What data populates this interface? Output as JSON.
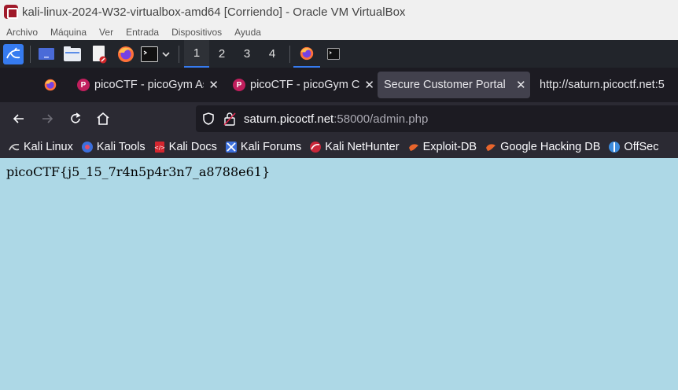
{
  "window": {
    "title": "kali-linux-2024-W32-virtualbox-amd64 [Corriendo] - Oracle VM VirtualBox",
    "menu": [
      "Archivo",
      "Máquina",
      "Ver",
      "Entrada",
      "Dispositivos",
      "Ayuda"
    ]
  },
  "panel": {
    "workspaces": [
      "1",
      "2",
      "3",
      "4"
    ],
    "active_workspace": "1"
  },
  "tabs": [
    {
      "label": "picoCTF - picoGym As",
      "favicon": "picoctf-icon",
      "active": false
    },
    {
      "label": "picoCTF - picoGym Cl",
      "favicon": "picoctf-icon",
      "active": false
    },
    {
      "label": "Secure Customer Portal",
      "favicon": "",
      "active": true
    },
    {
      "label": "http://saturn.picoctf.net:5",
      "favicon": "",
      "active": false
    }
  ],
  "address": {
    "host": "saturn.picoctf.net",
    "rest": ":58000/admin.php"
  },
  "bookmarks": [
    {
      "label": "Kali Linux",
      "icon": "kali-dragon-icon"
    },
    {
      "label": "Kali Tools",
      "icon": "kali-tools-icon"
    },
    {
      "label": "Kali Docs",
      "icon": "kali-docs-icon"
    },
    {
      "label": "Kali Forums",
      "icon": "kali-forums-icon"
    },
    {
      "label": "Kali NetHunter",
      "icon": "nethunter-icon"
    },
    {
      "label": "Exploit-DB",
      "icon": "exploit-db-icon"
    },
    {
      "label": "Google Hacking DB",
      "icon": "ghdb-icon"
    },
    {
      "label": "OffSec",
      "icon": "offsec-icon"
    }
  ],
  "page": {
    "flag": "picoCTF{j5_15_7r4n5p4r3n7_a8788e61}"
  }
}
